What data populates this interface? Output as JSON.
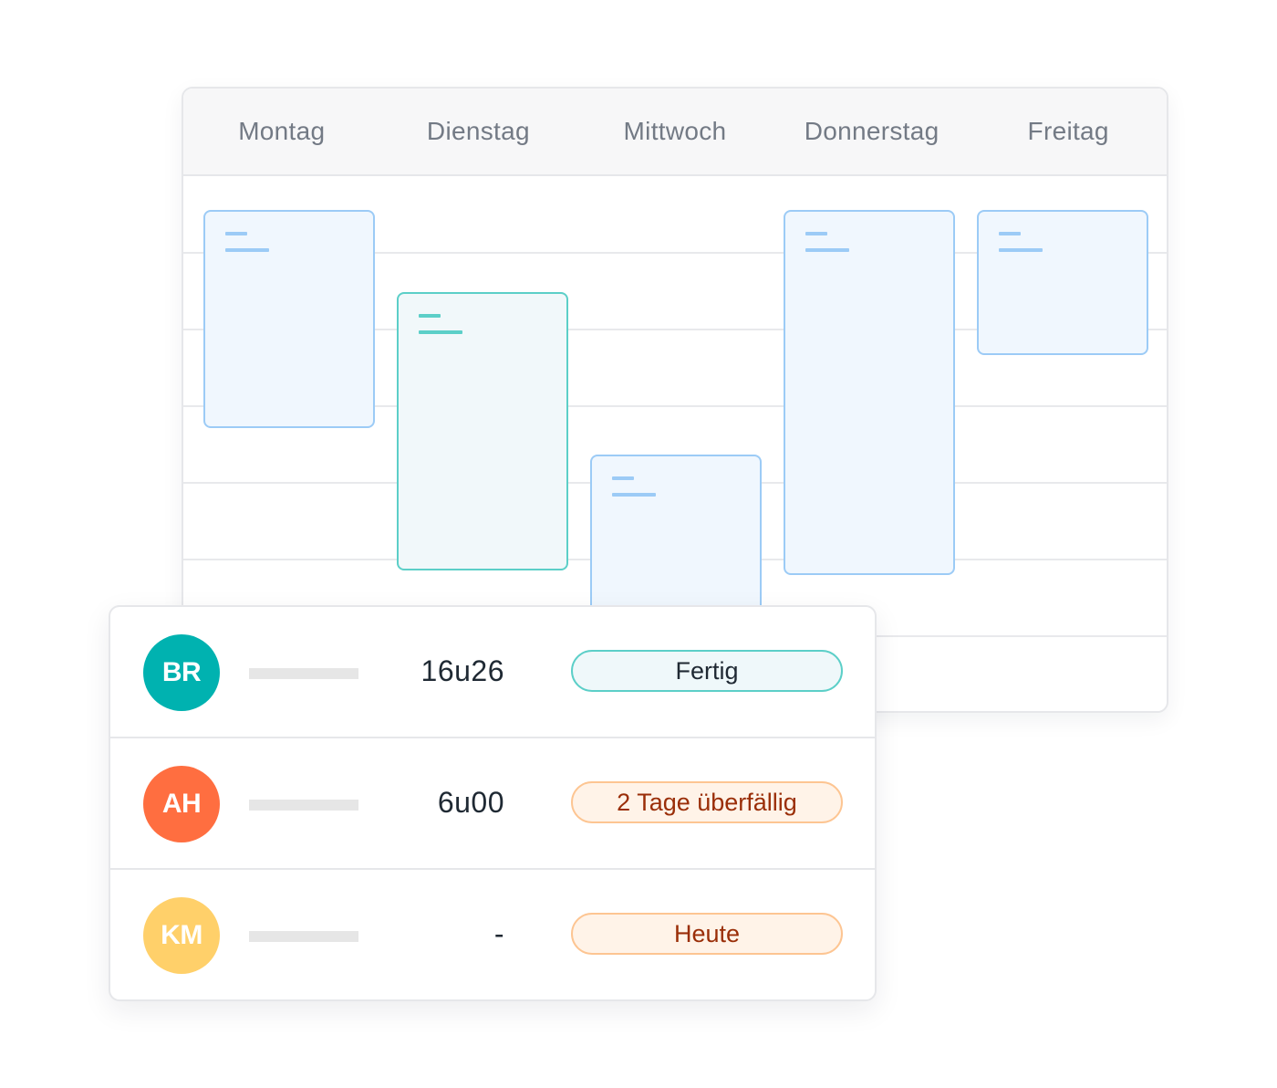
{
  "calendar": {
    "days": [
      "Montag",
      "Dienstag",
      "Mittwoch",
      "Donnerstag",
      "Freitag"
    ]
  },
  "tasks": [
    {
      "initials": "BR",
      "avatar_color": "#00b2b0",
      "time": "16u26",
      "status": "Fertig",
      "status_bg": "#eff8fa",
      "status_border": "#5ccfc8",
      "status_text": "#1f2933"
    },
    {
      "initials": "AH",
      "avatar_color": "#ff6e40",
      "time": "6u00",
      "status": "2 Tage überfällig",
      "status_bg": "#fff3e8",
      "status_border": "#fdc592",
      "status_text": "#9a2e08"
    },
    {
      "initials": "KM",
      "avatar_color": "#ffd06a",
      "time": "-",
      "status": "Heute",
      "status_bg": "#fff3e8",
      "status_border": "#fdc592",
      "status_text": "#9a2e08"
    }
  ]
}
